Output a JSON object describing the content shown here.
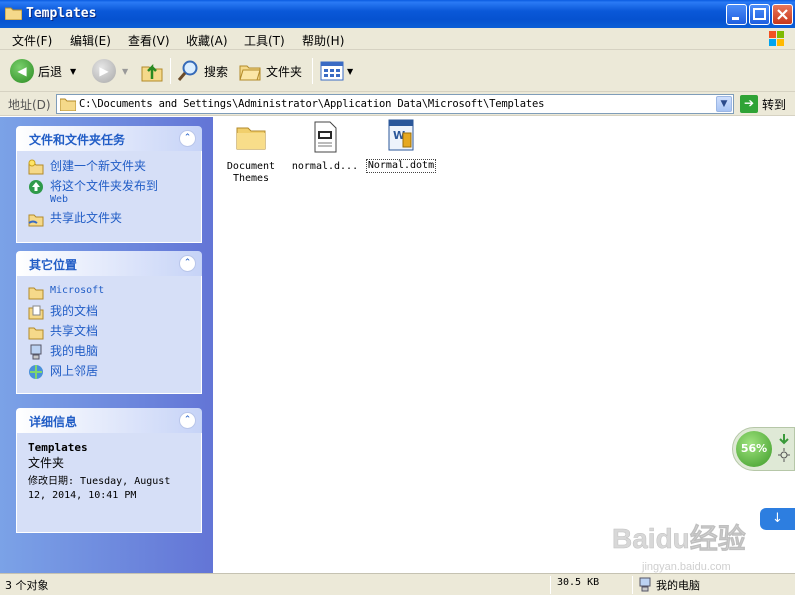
{
  "window": {
    "title": "Templates"
  },
  "menu": [
    "文件(F)",
    "编辑(E)",
    "查看(V)",
    "收藏(A)",
    "工具(T)",
    "帮助(H)"
  ],
  "toolbar": {
    "back_label": "后退",
    "search_label": "搜索",
    "folders_label": "文件夹"
  },
  "address": {
    "label": "地址(D)",
    "path": "C:\\Documents and Settings\\Administrator\\Application Data\\Microsoft\\Templates",
    "go_label": "转到"
  },
  "taskpane": {
    "file_tasks": {
      "title": "文件和文件夹任务",
      "items": [
        "创建一个新文件夹",
        "将这个文件夹发布到",
        "Web",
        "共享此文件夹"
      ]
    },
    "other_places": {
      "title": "其它位置",
      "items": [
        "Microsoft",
        "我的文档",
        "共享文档",
        "我的电脑",
        "网上邻居"
      ]
    },
    "details": {
      "title": "详细信息",
      "name": "Templates",
      "type": "文件夹",
      "modified_line1": "修改日期: Tuesday, August",
      "modified_line2": "12, 2014, 10:41 PM"
    }
  },
  "files": [
    {
      "name_line1": "Document",
      "name_line2": "Themes",
      "icon": "folder-icon"
    },
    {
      "name_line1": "normal.d...",
      "icon": "document-icon"
    },
    {
      "name_line1": "Normal.dotm",
      "icon": "word-template-icon"
    }
  ],
  "widget": {
    "percent": "56%"
  },
  "watermark": {
    "text": "Baidu经验",
    "sub": "jingyan.baidu.com"
  },
  "status": {
    "objects": "3 个对象",
    "size": "30.5 KB",
    "location": "我的电脑"
  },
  "colors": {
    "titlebar": "#0a58d8",
    "taskpane": "#6f8ede",
    "link": "#215dc6"
  }
}
